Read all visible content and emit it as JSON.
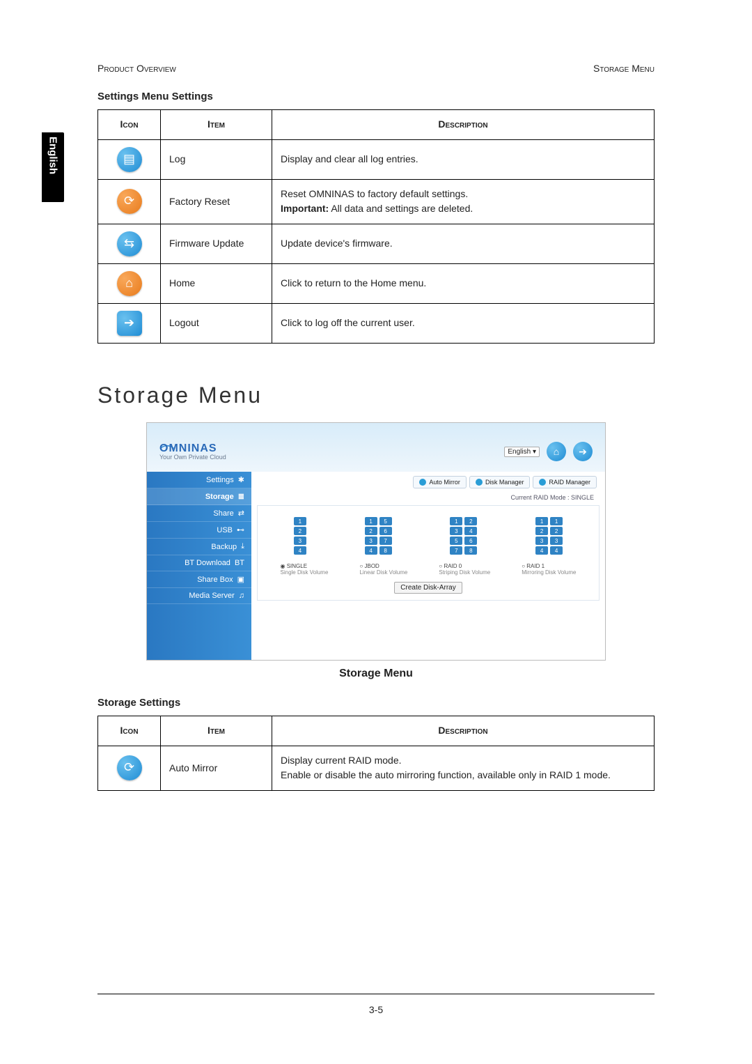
{
  "header": {
    "left": "Product Overview",
    "right": "Storage Menu"
  },
  "side_tab": "English",
  "table1": {
    "title": "Settings Menu Settings",
    "head": {
      "icon": "Icon",
      "item": "Item",
      "desc": "Description"
    },
    "rows": [
      {
        "icon": "log-icon",
        "glyph": "▤",
        "bg": "radial-gradient(circle at 30% 30%, #6ac1ef, #1f8cd4)",
        "shape": "circle",
        "item": "Log",
        "desc": "Display and clear all log entries."
      },
      {
        "icon": "factory-reset-icon",
        "glyph": "⟳",
        "bg": "radial-gradient(circle at 30% 30%, #f9a85a, #e87b1c)",
        "shape": "circle",
        "item": "Factory Reset",
        "desc_line1": "Reset OMNINAS to factory default settings.",
        "desc_bold": "Important:",
        "desc_rest": " All data and settings are deleted."
      },
      {
        "icon": "firmware-update-icon",
        "glyph": "⇆",
        "bg": "radial-gradient(circle at 30% 30%, #6ac1ef, #1f8cd4)",
        "shape": "circle",
        "item": "Firmware Update",
        "desc": "Update device's firmware."
      },
      {
        "icon": "home-icon",
        "glyph": "⌂",
        "bg": "radial-gradient(circle at 30% 30%, #f9a85a, #e87b1c)",
        "shape": "circle",
        "item": "Home",
        "desc": "Click to return to the Home menu."
      },
      {
        "icon": "logout-icon",
        "glyph": "➔",
        "bg": "radial-gradient(circle at 30% 30%, #6ac1ef, #1f8cd4)",
        "shape": "square",
        "item": "Logout",
        "desc": "Click to log off the current user."
      }
    ]
  },
  "big_heading": "Storage Menu",
  "screenshot": {
    "logo_name": "OMNINAS",
    "logo_tagline": "Your Own Private Cloud",
    "language_selected": "English",
    "sidebar": [
      {
        "label": "Settings",
        "icon": "✱"
      },
      {
        "label": "Storage",
        "icon": "≣",
        "active": true
      },
      {
        "label": "Share",
        "icon": "⇄"
      },
      {
        "label": "USB",
        "icon": "⊷"
      },
      {
        "label": "Backup",
        "icon": "⤓"
      },
      {
        "label": "BT Download",
        "icon": "BT"
      },
      {
        "label": "Share Box",
        "icon": "▣"
      },
      {
        "label": "Media Server",
        "icon": "♫"
      }
    ],
    "tabs": [
      {
        "label": "Auto Mirror"
      },
      {
        "label": "Disk Manager"
      },
      {
        "label": "RAID Manager"
      }
    ],
    "raid_mode_label": "Current RAID Mode : SINGLE",
    "modes": [
      {
        "name": "SINGLE",
        "desc": "Single Disk Volume",
        "selected": true,
        "slots": [
          [
            "1"
          ],
          [
            "2"
          ],
          [
            "3"
          ],
          [
            "4"
          ]
        ]
      },
      {
        "name": "JBOD",
        "desc": "Linear Disk Volume",
        "selected": false,
        "slots": [
          [
            "1",
            "5"
          ],
          [
            "2",
            "6"
          ],
          [
            "3",
            "7"
          ],
          [
            "4",
            "8"
          ]
        ]
      },
      {
        "name": "RAID 0",
        "desc": "Striping Disk Volume",
        "selected": false,
        "slots": [
          [
            "1",
            "2"
          ],
          [
            "3",
            "4"
          ],
          [
            "5",
            "6"
          ],
          [
            "7",
            "8"
          ]
        ]
      },
      {
        "name": "RAID 1",
        "desc": "Mirroring Disk Volume",
        "selected": false,
        "slots": [
          [
            "1",
            "1"
          ],
          [
            "2",
            "2"
          ],
          [
            "3",
            "3"
          ],
          [
            "4",
            "4"
          ]
        ]
      }
    ],
    "create_btn": "Create Disk-Array",
    "caption": "Storage Menu"
  },
  "table2": {
    "title": "Storage Settings",
    "head": {
      "icon": "Icon",
      "item": "Item",
      "desc": "Description"
    },
    "rows": [
      {
        "icon": "auto-mirror-icon",
        "glyph": "⟳",
        "bg": "radial-gradient(circle at 30% 30%, #6ac1ef, #1f8cd4)",
        "shape": "circle",
        "item": "Auto Mirror",
        "desc_line1": "Display current RAID mode.",
        "desc_line2": "Enable or disable the auto mirroring function, available only in RAID 1 mode."
      }
    ]
  },
  "page_number": "3-5"
}
